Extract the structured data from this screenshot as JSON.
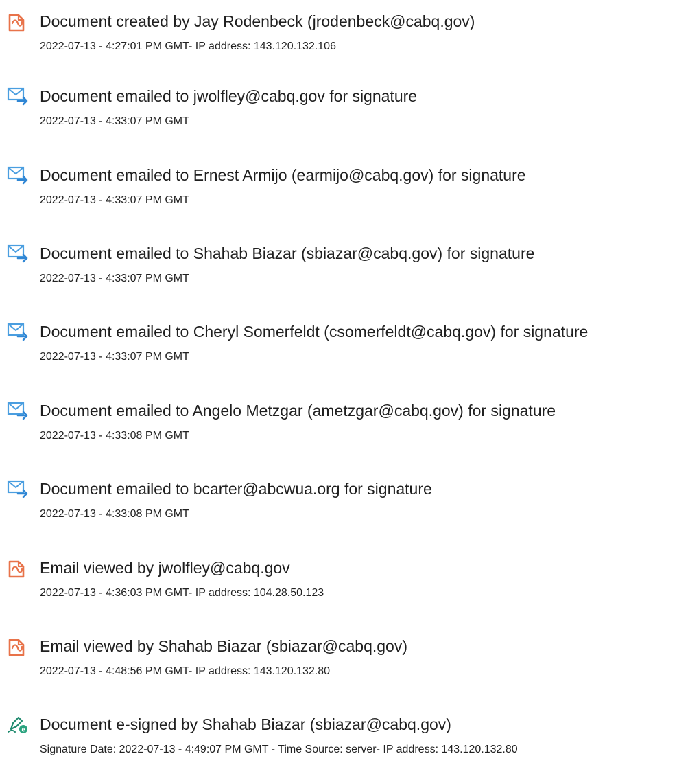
{
  "colors": {
    "document_icon": "#e8734a",
    "email_icon": "#4a9ee0",
    "email_arrow": "#2f86d4",
    "sign_icon": "#1f8a6e",
    "sign_badge": "#2aa37f"
  },
  "events": [
    {
      "icon": "document-icon",
      "title": "Document created by Jay Rodenbeck (jrodenbeck@cabq.gov)",
      "detail": "2022-07-13 - 4:27:01 PM GMT- IP address: 143.120.132.106"
    },
    {
      "icon": "email-sent-icon",
      "title": "Document emailed to jwolfley@cabq.gov for signature",
      "detail": "2022-07-13 - 4:33:07 PM GMT"
    },
    {
      "icon": "email-sent-icon",
      "title": "Document emailed to Ernest Armijo (earmijo@cabq.gov) for signature",
      "detail": "2022-07-13 - 4:33:07 PM GMT"
    },
    {
      "icon": "email-sent-icon",
      "title": "Document emailed to Shahab Biazar (sbiazar@cabq.gov) for signature",
      "detail": "2022-07-13 - 4:33:07 PM GMT"
    },
    {
      "icon": "email-sent-icon",
      "title": "Document emailed to Cheryl Somerfeldt (csomerfeldt@cabq.gov) for signature",
      "detail": "2022-07-13 - 4:33:07 PM GMT"
    },
    {
      "icon": "email-sent-icon",
      "title": "Document emailed to Angelo Metzgar (ametzgar@cabq.gov) for signature",
      "detail": "2022-07-13 - 4:33:08 PM GMT"
    },
    {
      "icon": "email-sent-icon",
      "title": "Document emailed to bcarter@abcwua.org for signature",
      "detail": "2022-07-13 - 4:33:08 PM GMT"
    },
    {
      "icon": "document-icon",
      "title": "Email viewed by jwolfley@cabq.gov",
      "detail": "2022-07-13 - 4:36:03 PM GMT- IP address: 104.28.50.123"
    },
    {
      "icon": "document-icon",
      "title": "Email viewed by Shahab Biazar (sbiazar@cabq.gov)",
      "detail": "2022-07-13 - 4:48:56 PM GMT- IP address: 143.120.132.80"
    },
    {
      "icon": "e-sign-icon",
      "title": "Document e-signed by Shahab Biazar (sbiazar@cabq.gov)",
      "detail": "Signature Date: 2022-07-13 - 4:49:07 PM GMT - Time Source: server- IP address: 143.120.132.80"
    }
  ]
}
